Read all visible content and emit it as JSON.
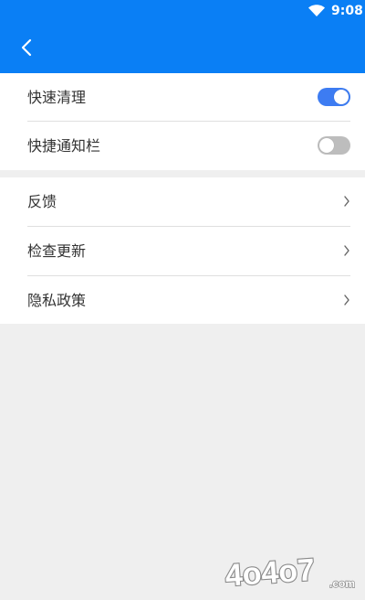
{
  "status_bar": {
    "time": "9:08",
    "wifi_icon": "wifi-icon"
  },
  "header": {
    "back_icon": "chevron-left-icon",
    "color": "#0a7ff5"
  },
  "settings": {
    "quick_clean": {
      "label": "快速清理",
      "enabled": true
    },
    "shortcut_notification": {
      "label": "快捷通知栏",
      "enabled": false
    }
  },
  "menu": {
    "items": [
      {
        "label": "反馈"
      },
      {
        "label": "检查更新"
      },
      {
        "label": "隐私政策"
      }
    ]
  },
  "watermark": {
    "text": "4o4o7.com"
  }
}
